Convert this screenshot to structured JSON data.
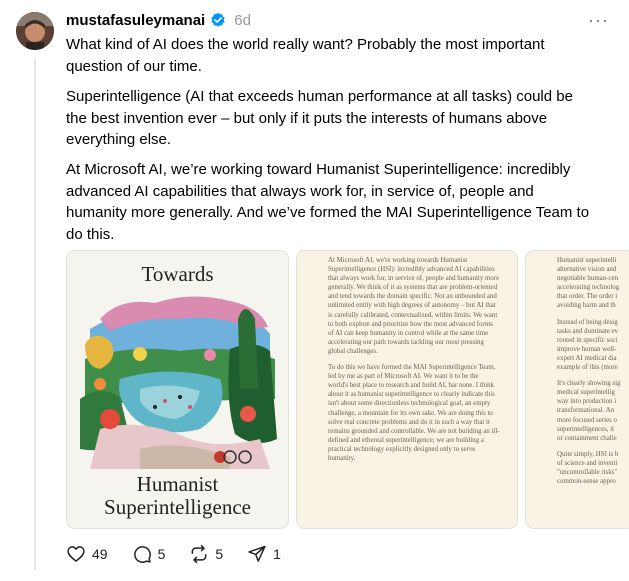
{
  "post": {
    "username": "mustafasuleymanai",
    "time": "6d",
    "more_label": "···",
    "paragraphs": [
      "What kind of AI does the world really want? Probably the most important question of our time.",
      "Superintelligence (AI that exceeds human performance at all tasks) could be the best invention ever – but only if it puts the interests of humans above everything else.",
      "At Microsoft AI, we’re working toward Humanist Superintelligence: incredibly advanced AI capabilities that always work for, in service of, people and humanity more generally. And we’ve formed the MAI Superintelligence Team to do this."
    ]
  },
  "media": {
    "cover": {
      "title_top": "Towards",
      "title_bottom_1": "Humanist",
      "title_bottom_2": "Superintelligence"
    },
    "page2": [
      "At Microsoft AI, we're working towards Humanist Superintelligence (HSI): incredibly advanced AI capabilities that always work for, in service of, people and humanity more generally. We think of it as systems that are problem-oriented and tend towards the domain specific. Not an unbounded and unlimited entity with high degrees of autonomy – but AI that is carefully calibrated, contextualized, within limits. We want to both explore and prioritize how the most advanced forms of AI can keep humanity in control while at the same time accelerating our path towards tackling our most pressing global challenges.",
      "To do this we have formed the MAI Superintelligence Team, led by me as part of Microsoft AI. We want it to be the world's best place to research and build AI, bar none. I think about it as humanist superintelligence to clearly indicate this isn't about some directionless technological goal, an empty challenge, a mountain for its own sake. We are doing this to solve real concrete problems and do it in such a way that it remains grounded and controllable. We are not building an ill-defined and ethereal superintelligence; we are building a practical technology explicitly designed only to serve humanity."
    ],
    "page3": [
      [
        "Humanist superintelli",
        "alternative vision and",
        "negotiable human-cen",
        "accelerating technolog",
        "that order. The order i",
        "avoiding harm and th"
      ],
      [
        "Instead of being desig",
        "tasks and dominate ev",
        "rooted in specific soci",
        "improve human well-",
        "expert AI medical dia",
        "example of this (more"
      ],
      [
        "It's clearly showing sig",
        "medical superintellig",
        "way into production i",
        "transformational. An",
        "more focused series o",
        "superintelligences, it",
        "or containment challe"
      ],
      [
        "Quite simply, HSI is b",
        "of science and inventi",
        "\"uncontrollable risks\"",
        "common-sense appro"
      ]
    ]
  },
  "actions": {
    "likes": "49",
    "comments": "5",
    "reposts": "5",
    "shares": "1"
  },
  "colors": {
    "verified": "#0095f6",
    "muted_text": "#999999",
    "page_background": "#f9f3e5"
  }
}
